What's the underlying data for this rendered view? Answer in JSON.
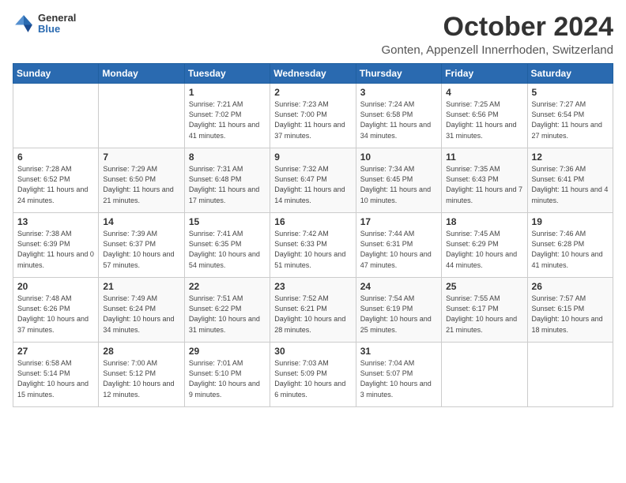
{
  "header": {
    "logo_general": "General",
    "logo_blue": "Blue",
    "month_title": "October 2024",
    "location": "Gonten, Appenzell Innerrhoden, Switzerland"
  },
  "weekdays": [
    "Sunday",
    "Monday",
    "Tuesday",
    "Wednesday",
    "Thursday",
    "Friday",
    "Saturday"
  ],
  "weeks": [
    [
      {
        "day": "",
        "sunrise": "",
        "sunset": "",
        "daylight": ""
      },
      {
        "day": "",
        "sunrise": "",
        "sunset": "",
        "daylight": ""
      },
      {
        "day": "1",
        "sunrise": "Sunrise: 7:21 AM",
        "sunset": "Sunset: 7:02 PM",
        "daylight": "Daylight: 11 hours and 41 minutes."
      },
      {
        "day": "2",
        "sunrise": "Sunrise: 7:23 AM",
        "sunset": "Sunset: 7:00 PM",
        "daylight": "Daylight: 11 hours and 37 minutes."
      },
      {
        "day": "3",
        "sunrise": "Sunrise: 7:24 AM",
        "sunset": "Sunset: 6:58 PM",
        "daylight": "Daylight: 11 hours and 34 minutes."
      },
      {
        "day": "4",
        "sunrise": "Sunrise: 7:25 AM",
        "sunset": "Sunset: 6:56 PM",
        "daylight": "Daylight: 11 hours and 31 minutes."
      },
      {
        "day": "5",
        "sunrise": "Sunrise: 7:27 AM",
        "sunset": "Sunset: 6:54 PM",
        "daylight": "Daylight: 11 hours and 27 minutes."
      }
    ],
    [
      {
        "day": "6",
        "sunrise": "Sunrise: 7:28 AM",
        "sunset": "Sunset: 6:52 PM",
        "daylight": "Daylight: 11 hours and 24 minutes."
      },
      {
        "day": "7",
        "sunrise": "Sunrise: 7:29 AM",
        "sunset": "Sunset: 6:50 PM",
        "daylight": "Daylight: 11 hours and 21 minutes."
      },
      {
        "day": "8",
        "sunrise": "Sunrise: 7:31 AM",
        "sunset": "Sunset: 6:48 PM",
        "daylight": "Daylight: 11 hours and 17 minutes."
      },
      {
        "day": "9",
        "sunrise": "Sunrise: 7:32 AM",
        "sunset": "Sunset: 6:47 PM",
        "daylight": "Daylight: 11 hours and 14 minutes."
      },
      {
        "day": "10",
        "sunrise": "Sunrise: 7:34 AM",
        "sunset": "Sunset: 6:45 PM",
        "daylight": "Daylight: 11 hours and 10 minutes."
      },
      {
        "day": "11",
        "sunrise": "Sunrise: 7:35 AM",
        "sunset": "Sunset: 6:43 PM",
        "daylight": "Daylight: 11 hours and 7 minutes."
      },
      {
        "day": "12",
        "sunrise": "Sunrise: 7:36 AM",
        "sunset": "Sunset: 6:41 PM",
        "daylight": "Daylight: 11 hours and 4 minutes."
      }
    ],
    [
      {
        "day": "13",
        "sunrise": "Sunrise: 7:38 AM",
        "sunset": "Sunset: 6:39 PM",
        "daylight": "Daylight: 11 hours and 0 minutes."
      },
      {
        "day": "14",
        "sunrise": "Sunrise: 7:39 AM",
        "sunset": "Sunset: 6:37 PM",
        "daylight": "Daylight: 10 hours and 57 minutes."
      },
      {
        "day": "15",
        "sunrise": "Sunrise: 7:41 AM",
        "sunset": "Sunset: 6:35 PM",
        "daylight": "Daylight: 10 hours and 54 minutes."
      },
      {
        "day": "16",
        "sunrise": "Sunrise: 7:42 AM",
        "sunset": "Sunset: 6:33 PM",
        "daylight": "Daylight: 10 hours and 51 minutes."
      },
      {
        "day": "17",
        "sunrise": "Sunrise: 7:44 AM",
        "sunset": "Sunset: 6:31 PM",
        "daylight": "Daylight: 10 hours and 47 minutes."
      },
      {
        "day": "18",
        "sunrise": "Sunrise: 7:45 AM",
        "sunset": "Sunset: 6:29 PM",
        "daylight": "Daylight: 10 hours and 44 minutes."
      },
      {
        "day": "19",
        "sunrise": "Sunrise: 7:46 AM",
        "sunset": "Sunset: 6:28 PM",
        "daylight": "Daylight: 10 hours and 41 minutes."
      }
    ],
    [
      {
        "day": "20",
        "sunrise": "Sunrise: 7:48 AM",
        "sunset": "Sunset: 6:26 PM",
        "daylight": "Daylight: 10 hours and 37 minutes."
      },
      {
        "day": "21",
        "sunrise": "Sunrise: 7:49 AM",
        "sunset": "Sunset: 6:24 PM",
        "daylight": "Daylight: 10 hours and 34 minutes."
      },
      {
        "day": "22",
        "sunrise": "Sunrise: 7:51 AM",
        "sunset": "Sunset: 6:22 PM",
        "daylight": "Daylight: 10 hours and 31 minutes."
      },
      {
        "day": "23",
        "sunrise": "Sunrise: 7:52 AM",
        "sunset": "Sunset: 6:21 PM",
        "daylight": "Daylight: 10 hours and 28 minutes."
      },
      {
        "day": "24",
        "sunrise": "Sunrise: 7:54 AM",
        "sunset": "Sunset: 6:19 PM",
        "daylight": "Daylight: 10 hours and 25 minutes."
      },
      {
        "day": "25",
        "sunrise": "Sunrise: 7:55 AM",
        "sunset": "Sunset: 6:17 PM",
        "daylight": "Daylight: 10 hours and 21 minutes."
      },
      {
        "day": "26",
        "sunrise": "Sunrise: 7:57 AM",
        "sunset": "Sunset: 6:15 PM",
        "daylight": "Daylight: 10 hours and 18 minutes."
      }
    ],
    [
      {
        "day": "27",
        "sunrise": "Sunrise: 6:58 AM",
        "sunset": "Sunset: 5:14 PM",
        "daylight": "Daylight: 10 hours and 15 minutes."
      },
      {
        "day": "28",
        "sunrise": "Sunrise: 7:00 AM",
        "sunset": "Sunset: 5:12 PM",
        "daylight": "Daylight: 10 hours and 12 minutes."
      },
      {
        "day": "29",
        "sunrise": "Sunrise: 7:01 AM",
        "sunset": "Sunset: 5:10 PM",
        "daylight": "Daylight: 10 hours and 9 minutes."
      },
      {
        "day": "30",
        "sunrise": "Sunrise: 7:03 AM",
        "sunset": "Sunset: 5:09 PM",
        "daylight": "Daylight: 10 hours and 6 minutes."
      },
      {
        "day": "31",
        "sunrise": "Sunrise: 7:04 AM",
        "sunset": "Sunset: 5:07 PM",
        "daylight": "Daylight: 10 hours and 3 minutes."
      },
      {
        "day": "",
        "sunrise": "",
        "sunset": "",
        "daylight": ""
      },
      {
        "day": "",
        "sunrise": "",
        "sunset": "",
        "daylight": ""
      }
    ]
  ]
}
